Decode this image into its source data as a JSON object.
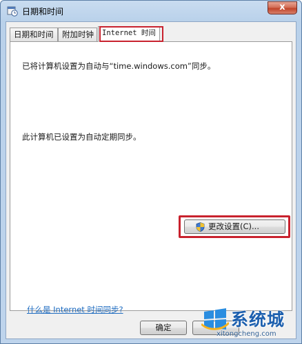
{
  "window": {
    "title": "日期和时间",
    "close_label": "x"
  },
  "tabs": [
    {
      "label": "日期和时间",
      "active": false
    },
    {
      "label": "附加时钟",
      "active": false
    },
    {
      "label": "Internet 时间",
      "active": true
    }
  ],
  "panel": {
    "sync_status": "已将计算机设置为自动与“time.windows.com”同步。",
    "auto_status": "此计算机已设置为自动定期同步。",
    "change_button_label": "更改设置(C)...",
    "help_link_text": "什么是 Internet 时间同步?"
  },
  "footer": {
    "ok_label": "确定"
  },
  "watermark": {
    "brand_text": "系统城",
    "url_text": "xitongcheng.com"
  },
  "colors": {
    "highlight_red": "#c8212d",
    "link_blue": "#1f6cc0",
    "frame_blue": "#b9d1ea"
  },
  "icons": [
    "calendar-clock-icon",
    "close-icon",
    "uac-shield-icon",
    "windows-logo-icon"
  ]
}
